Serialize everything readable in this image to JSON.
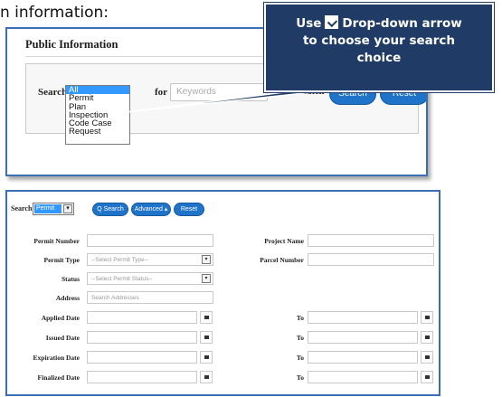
{
  "intro_text": "n information:",
  "callout": {
    "word_use": "Use",
    "line1_rest": "Drop-down arrow",
    "line2": "to choose your search",
    "line3": "choice"
  },
  "public_info": {
    "title": "Public Information",
    "search_label": "Search",
    "options": [
      "All",
      "Permit",
      "Plan",
      "Inspection",
      "Code Case",
      "Request"
    ],
    "selected_option": "All",
    "for_label": "for",
    "keywords_placeholder": "Keywords",
    "exact_match_label": "Exact Match",
    "search_button": "Search",
    "reset_button": "Reset"
  },
  "permit_search": {
    "search_label": "Search",
    "selected_type": "Permit",
    "search_button": "Q Search",
    "advanced_button": "Advanced ▴",
    "reset_button": "Reset",
    "fields": {
      "permit_number": "Permit Number",
      "project_name": "Project Name",
      "permit_type": "Permit Type",
      "permit_type_placeholder": "--Select Permit Type--",
      "parcel_number": "Parcel Number",
      "status": "Status",
      "status_placeholder": "--Select Permit Status--",
      "address": "Address",
      "address_placeholder": "Search Addresses",
      "applied_date": "Applied Date",
      "issued_date": "Issued Date",
      "expiration_date": "Expiration Date",
      "finalized_date": "Finalized Date",
      "to": "To"
    }
  },
  "colors": {
    "callout_bg": "#1f3b66",
    "button_blue": "#1f73c8",
    "frame_blue": "#3a6fb5",
    "selection_blue": "#3399ff"
  }
}
